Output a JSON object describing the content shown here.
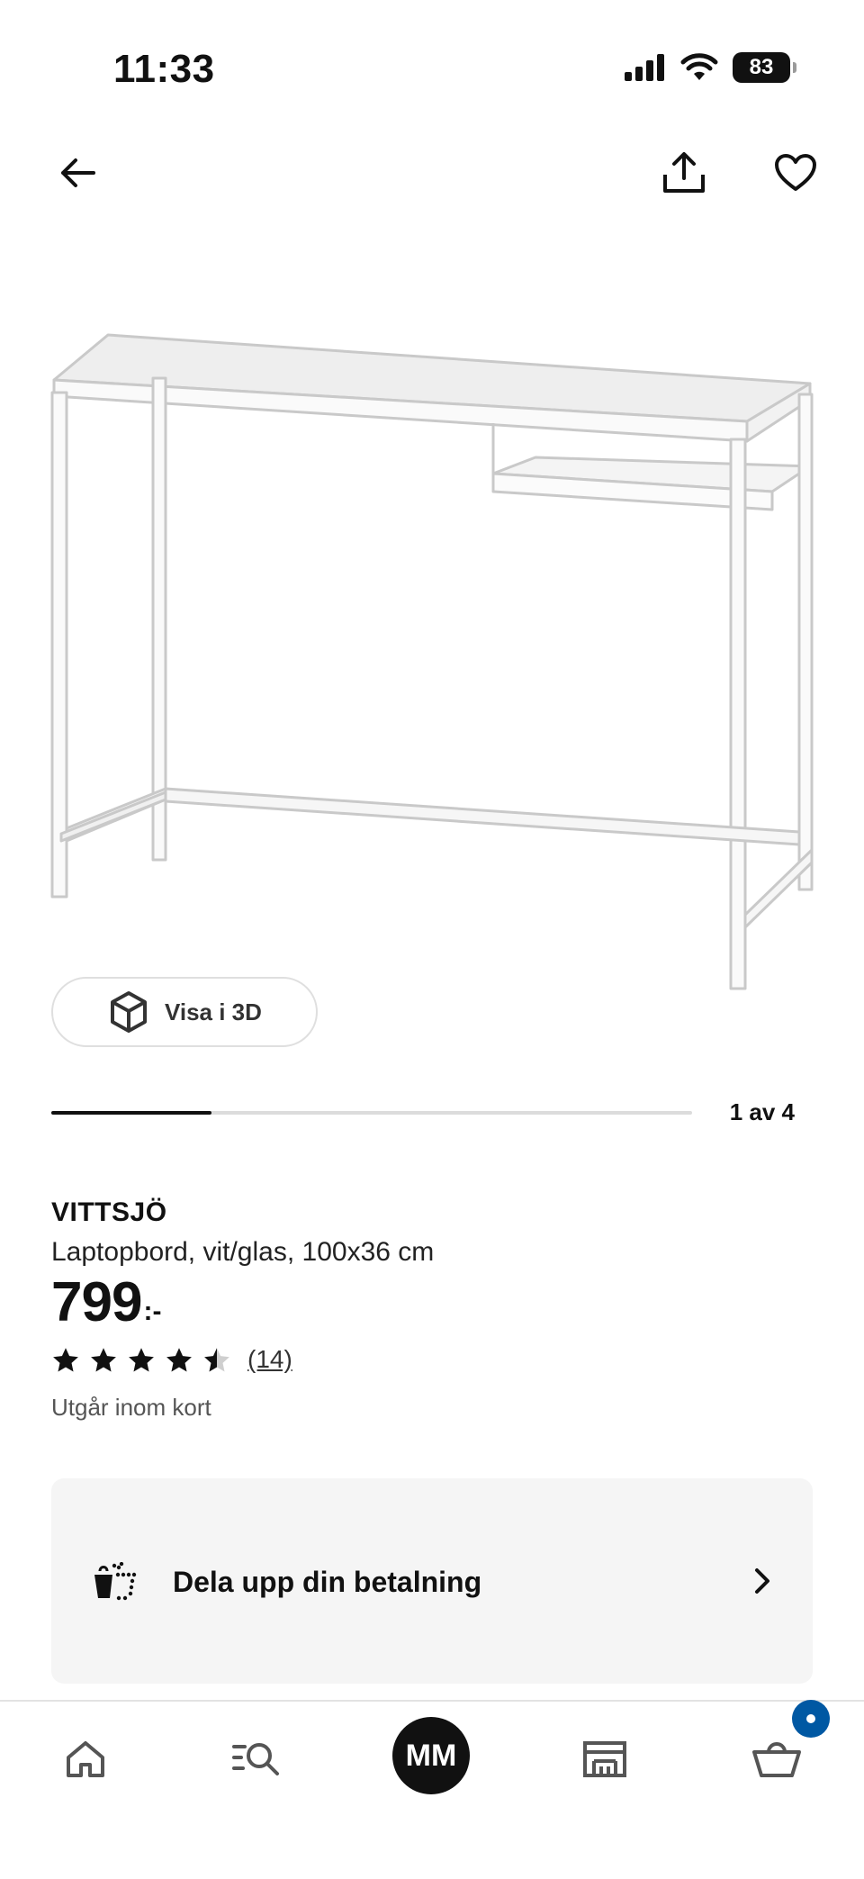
{
  "status_bar": {
    "time": "11:33",
    "battery": "83",
    "icons": [
      "signal-icon",
      "wifi-icon",
      "battery-icon"
    ]
  },
  "top_nav": {
    "icons": [
      "back-arrow-icon",
      "share-icon",
      "heart-icon"
    ]
  },
  "gallery": {
    "view_3d_label": "Visa i 3D",
    "position_text": "1 av 4",
    "current": 1,
    "total": 4
  },
  "product": {
    "brand": "VITTSJÖ",
    "description": "Laptopbord, vit/glas, 100x36 cm",
    "price_integer": "799",
    "price_suffix": ":-",
    "rating_value": 4.5,
    "rating_max": 5,
    "review_count": "(14)",
    "availability": "Utgår inom kort"
  },
  "payment": {
    "label": "Dela upp din betalning"
  },
  "tab_bar": {
    "avatar_initials": "MM",
    "icons": [
      "home-icon",
      "search-list-icon",
      "store-icon",
      "cart-icon"
    ]
  },
  "colors": {
    "accent_blue": "#0058a3",
    "text": "#111111",
    "card_bg": "#f5f5f5"
  }
}
